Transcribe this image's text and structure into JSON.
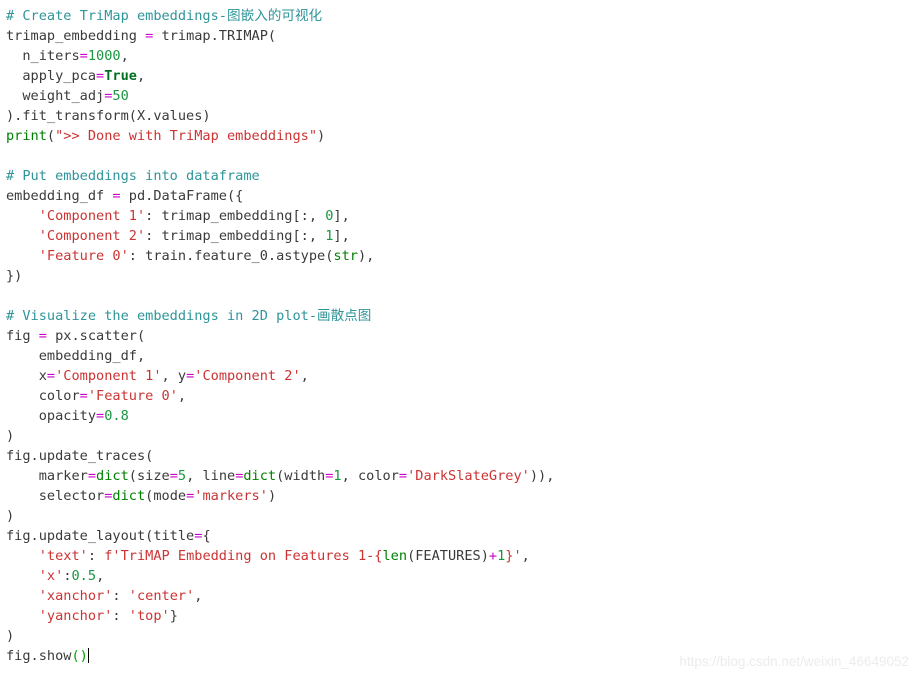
{
  "editor": {
    "language": "python",
    "background_color": "#ffffff",
    "default_text_color": "#3a3a3a",
    "colors": {
      "comment": "#2e9599",
      "string": "#cc3333",
      "number": "#1a9641",
      "builtin": "#008000",
      "keyword": "#007020",
      "operator": "#cc00cc",
      "bracket_match": "#00a000"
    },
    "caret_visible": true
  },
  "watermark": {
    "text": "https://blog.csdn.net/weixin_46649052"
  },
  "code": {
    "lines": [
      {
        "index": 1,
        "text": "# Create TriMap embeddings-图嵌入的可视化",
        "tokens": [
          {
            "t": "# Create TriMap embeddings-图嵌入的可视化",
            "c": "comment"
          }
        ]
      },
      {
        "index": 2,
        "text": "trimap_embedding = trimap.TRIMAP(",
        "tokens": [
          {
            "t": "trimap_embedding ",
            "c": "plain"
          },
          {
            "t": "=",
            "c": "operator"
          },
          {
            "t": " trimap.TRIMAP(",
            "c": "plain"
          }
        ]
      },
      {
        "index": 3,
        "text": "  n_iters=1000,",
        "tokens": [
          {
            "t": "  n_iters",
            "c": "plain"
          },
          {
            "t": "=",
            "c": "operator"
          },
          {
            "t": "1000",
            "c": "number"
          },
          {
            "t": ",",
            "c": "plain"
          }
        ]
      },
      {
        "index": 4,
        "text": "  apply_pca=True,",
        "tokens": [
          {
            "t": "  apply_pca",
            "c": "plain"
          },
          {
            "t": "=",
            "c": "operator"
          },
          {
            "t": "True",
            "c": "keyword"
          },
          {
            "t": ",",
            "c": "plain"
          }
        ]
      },
      {
        "index": 5,
        "text": "  weight_adj=50",
        "tokens": [
          {
            "t": "  weight_adj",
            "c": "plain"
          },
          {
            "t": "=",
            "c": "operator"
          },
          {
            "t": "50",
            "c": "number"
          }
        ]
      },
      {
        "index": 6,
        "text": ").fit_transform(X.values)",
        "tokens": [
          {
            "t": ").fit_transform(X.values)",
            "c": "plain"
          }
        ]
      },
      {
        "index": 7,
        "text": "print(\">> Done with TriMap embeddings\")",
        "tokens": [
          {
            "t": "print",
            "c": "builtin"
          },
          {
            "t": "(",
            "c": "plain"
          },
          {
            "t": "\">> Done with TriMap embeddings\"",
            "c": "string"
          },
          {
            "t": ")",
            "c": "plain"
          }
        ]
      },
      {
        "index": 8,
        "text": "",
        "tokens": []
      },
      {
        "index": 9,
        "text": "# Put embeddings into dataframe",
        "tokens": [
          {
            "t": "# Put embeddings into dataframe",
            "c": "comment"
          }
        ]
      },
      {
        "index": 10,
        "text": "embedding_df = pd.DataFrame({",
        "tokens": [
          {
            "t": "embedding_df ",
            "c": "plain"
          },
          {
            "t": "=",
            "c": "operator"
          },
          {
            "t": " pd.DataFrame({",
            "c": "plain"
          }
        ]
      },
      {
        "index": 11,
        "text": "    'Component 1': trimap_embedding[:, 0],",
        "tokens": [
          {
            "t": "    ",
            "c": "plain"
          },
          {
            "t": "'Component 1'",
            "c": "string"
          },
          {
            "t": ": trimap_embedding[:, ",
            "c": "plain"
          },
          {
            "t": "0",
            "c": "number"
          },
          {
            "t": "],",
            "c": "plain"
          }
        ]
      },
      {
        "index": 12,
        "text": "    'Component 2': trimap_embedding[:, 1],",
        "tokens": [
          {
            "t": "    ",
            "c": "plain"
          },
          {
            "t": "'Component 2'",
            "c": "string"
          },
          {
            "t": ": trimap_embedding[:, ",
            "c": "plain"
          },
          {
            "t": "1",
            "c": "number"
          },
          {
            "t": "],",
            "c": "plain"
          }
        ]
      },
      {
        "index": 13,
        "text": "    'Feature 0': train.feature_0.astype(str),",
        "tokens": [
          {
            "t": "    ",
            "c": "plain"
          },
          {
            "t": "'Feature 0'",
            "c": "string"
          },
          {
            "t": ": train.feature_0.astype(",
            "c": "plain"
          },
          {
            "t": "str",
            "c": "builtin"
          },
          {
            "t": "),",
            "c": "plain"
          }
        ]
      },
      {
        "index": 14,
        "text": "})",
        "tokens": [
          {
            "t": "})",
            "c": "plain"
          }
        ]
      },
      {
        "index": 15,
        "text": "",
        "tokens": []
      },
      {
        "index": 16,
        "text": "# Visualize the embeddings in 2D plot-画散点图",
        "tokens": [
          {
            "t": "# Visualize the embeddings in 2D plot-画散点图",
            "c": "comment"
          }
        ]
      },
      {
        "index": 17,
        "text": "fig = px.scatter(",
        "tokens": [
          {
            "t": "fig ",
            "c": "plain"
          },
          {
            "t": "=",
            "c": "operator"
          },
          {
            "t": " px.scatter(",
            "c": "plain"
          }
        ]
      },
      {
        "index": 18,
        "text": "    embedding_df,",
        "tokens": [
          {
            "t": "    embedding_df,",
            "c": "plain"
          }
        ]
      },
      {
        "index": 19,
        "text": "    x='Component 1', y='Component 2',",
        "tokens": [
          {
            "t": "    x",
            "c": "plain"
          },
          {
            "t": "=",
            "c": "operator"
          },
          {
            "t": "'Component 1'",
            "c": "string"
          },
          {
            "t": ", y",
            "c": "plain"
          },
          {
            "t": "=",
            "c": "operator"
          },
          {
            "t": "'Component 2'",
            "c": "string"
          },
          {
            "t": ",",
            "c": "plain"
          }
        ]
      },
      {
        "index": 20,
        "text": "    color='Feature 0',",
        "tokens": [
          {
            "t": "    color",
            "c": "plain"
          },
          {
            "t": "=",
            "c": "operator"
          },
          {
            "t": "'Feature 0'",
            "c": "string"
          },
          {
            "t": ",",
            "c": "plain"
          }
        ]
      },
      {
        "index": 21,
        "text": "    opacity=0.8",
        "tokens": [
          {
            "t": "    opacity",
            "c": "plain"
          },
          {
            "t": "=",
            "c": "operator"
          },
          {
            "t": "0.8",
            "c": "number"
          }
        ]
      },
      {
        "index": 22,
        "text": ")",
        "tokens": [
          {
            "t": ")",
            "c": "plain"
          }
        ]
      },
      {
        "index": 23,
        "text": "fig.update_traces(",
        "tokens": [
          {
            "t": "fig.update_traces(",
            "c": "plain"
          }
        ]
      },
      {
        "index": 24,
        "text": "    marker=dict(size=5, line=dict(width=1, color='DarkSlateGrey')),",
        "tokens": [
          {
            "t": "    marker",
            "c": "plain"
          },
          {
            "t": "=",
            "c": "operator"
          },
          {
            "t": "dict",
            "c": "builtin"
          },
          {
            "t": "(size",
            "c": "plain"
          },
          {
            "t": "=",
            "c": "operator"
          },
          {
            "t": "5",
            "c": "number"
          },
          {
            "t": ", line",
            "c": "plain"
          },
          {
            "t": "=",
            "c": "operator"
          },
          {
            "t": "dict",
            "c": "builtin"
          },
          {
            "t": "(width",
            "c": "plain"
          },
          {
            "t": "=",
            "c": "operator"
          },
          {
            "t": "1",
            "c": "number"
          },
          {
            "t": ", color",
            "c": "plain"
          },
          {
            "t": "=",
            "c": "operator"
          },
          {
            "t": "'DarkSlateGrey'",
            "c": "string"
          },
          {
            "t": ")),",
            "c": "plain"
          }
        ]
      },
      {
        "index": 25,
        "text": "    selector=dict(mode='markers')",
        "tokens": [
          {
            "t": "    selector",
            "c": "plain"
          },
          {
            "t": "=",
            "c": "operator"
          },
          {
            "t": "dict",
            "c": "builtin"
          },
          {
            "t": "(mode",
            "c": "plain"
          },
          {
            "t": "=",
            "c": "operator"
          },
          {
            "t": "'markers'",
            "c": "string"
          },
          {
            "t": ")",
            "c": "plain"
          }
        ]
      },
      {
        "index": 26,
        "text": ")",
        "tokens": [
          {
            "t": ")",
            "c": "plain"
          }
        ]
      },
      {
        "index": 27,
        "text": "fig.update_layout(title={",
        "tokens": [
          {
            "t": "fig.update_layout(title",
            "c": "plain"
          },
          {
            "t": "=",
            "c": "operator"
          },
          {
            "t": "{",
            "c": "plain"
          }
        ]
      },
      {
        "index": 28,
        "text": "    'text': f'TriMAP Embedding on Features 1-{len(FEATURES)+1}',",
        "tokens": [
          {
            "t": "    ",
            "c": "plain"
          },
          {
            "t": "'text'",
            "c": "string"
          },
          {
            "t": ": ",
            "c": "plain"
          },
          {
            "t": "f'TriMAP Embedding on Features 1-{",
            "c": "string"
          },
          {
            "t": "len",
            "c": "builtin"
          },
          {
            "t": "(FEATURES)",
            "c": "plain"
          },
          {
            "t": "+",
            "c": "operator"
          },
          {
            "t": "1",
            "c": "number"
          },
          {
            "t": "}'",
            "c": "string"
          },
          {
            "t": ",",
            "c": "plain"
          }
        ]
      },
      {
        "index": 29,
        "text": "    'x':0.5,",
        "tokens": [
          {
            "t": "    ",
            "c": "plain"
          },
          {
            "t": "'x'",
            "c": "string"
          },
          {
            "t": ":",
            "c": "plain"
          },
          {
            "t": "0.5",
            "c": "number"
          },
          {
            "t": ",",
            "c": "plain"
          }
        ]
      },
      {
        "index": 30,
        "text": "    'xanchor': 'center',",
        "tokens": [
          {
            "t": "    ",
            "c": "plain"
          },
          {
            "t": "'xanchor'",
            "c": "string"
          },
          {
            "t": ": ",
            "c": "plain"
          },
          {
            "t": "'center'",
            "c": "string"
          },
          {
            "t": ",",
            "c": "plain"
          }
        ]
      },
      {
        "index": 31,
        "text": "    'yanchor': 'top'}",
        "tokens": [
          {
            "t": "    ",
            "c": "plain"
          },
          {
            "t": "'yanchor'",
            "c": "string"
          },
          {
            "t": ": ",
            "c": "plain"
          },
          {
            "t": "'top'",
            "c": "string"
          },
          {
            "t": "}",
            "c": "plain"
          }
        ]
      },
      {
        "index": 32,
        "text": ")",
        "tokens": [
          {
            "t": ")",
            "c": "plain"
          }
        ]
      },
      {
        "index": 33,
        "text": "fig.show()",
        "caret_after": true,
        "tokens": [
          {
            "t": "fig.show",
            "c": "plain"
          },
          {
            "t": "()",
            "c": "bracket"
          }
        ]
      }
    ]
  }
}
